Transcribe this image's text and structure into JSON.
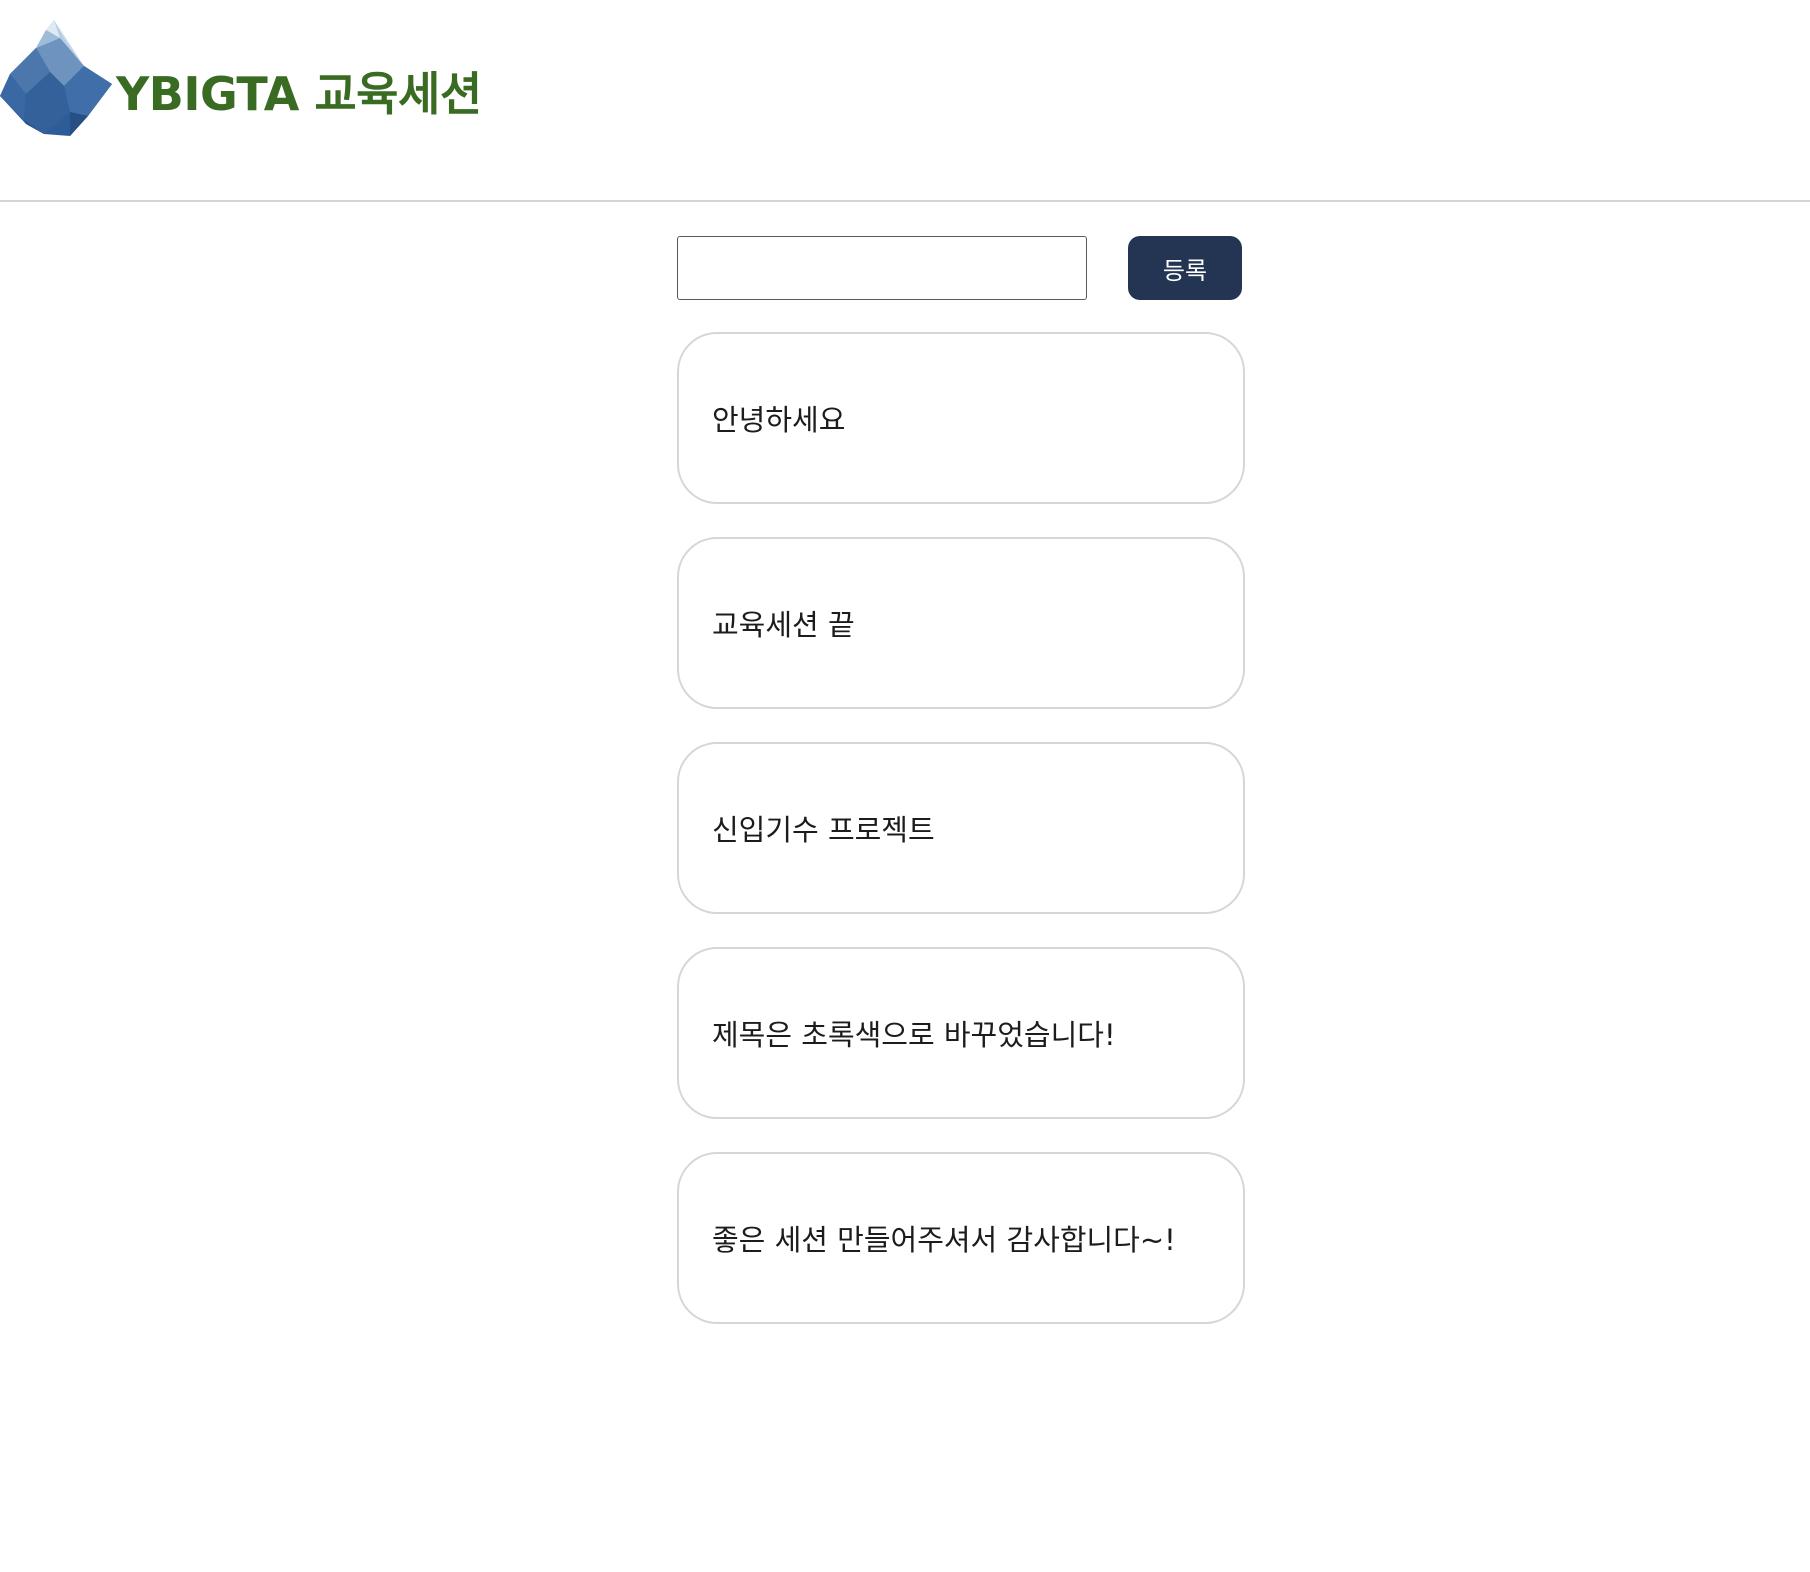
{
  "header": {
    "logo_icon": "iceberg-logo-icon",
    "title": "YBIGTA 교육세션",
    "title_color": "#3a6b22"
  },
  "form": {
    "input_value": "",
    "input_placeholder": "",
    "submit_label": "등록",
    "submit_color": "#233553"
  },
  "items": [
    {
      "text": "안녕하세요"
    },
    {
      "text": "교육세션 끝"
    },
    {
      "text": "신입기수 프로젝트"
    },
    {
      "text": "제목은 초록색으로 바꾸었습니다!"
    },
    {
      "text": "좋은 세션 만들어주셔서 감사합니다~!"
    }
  ]
}
